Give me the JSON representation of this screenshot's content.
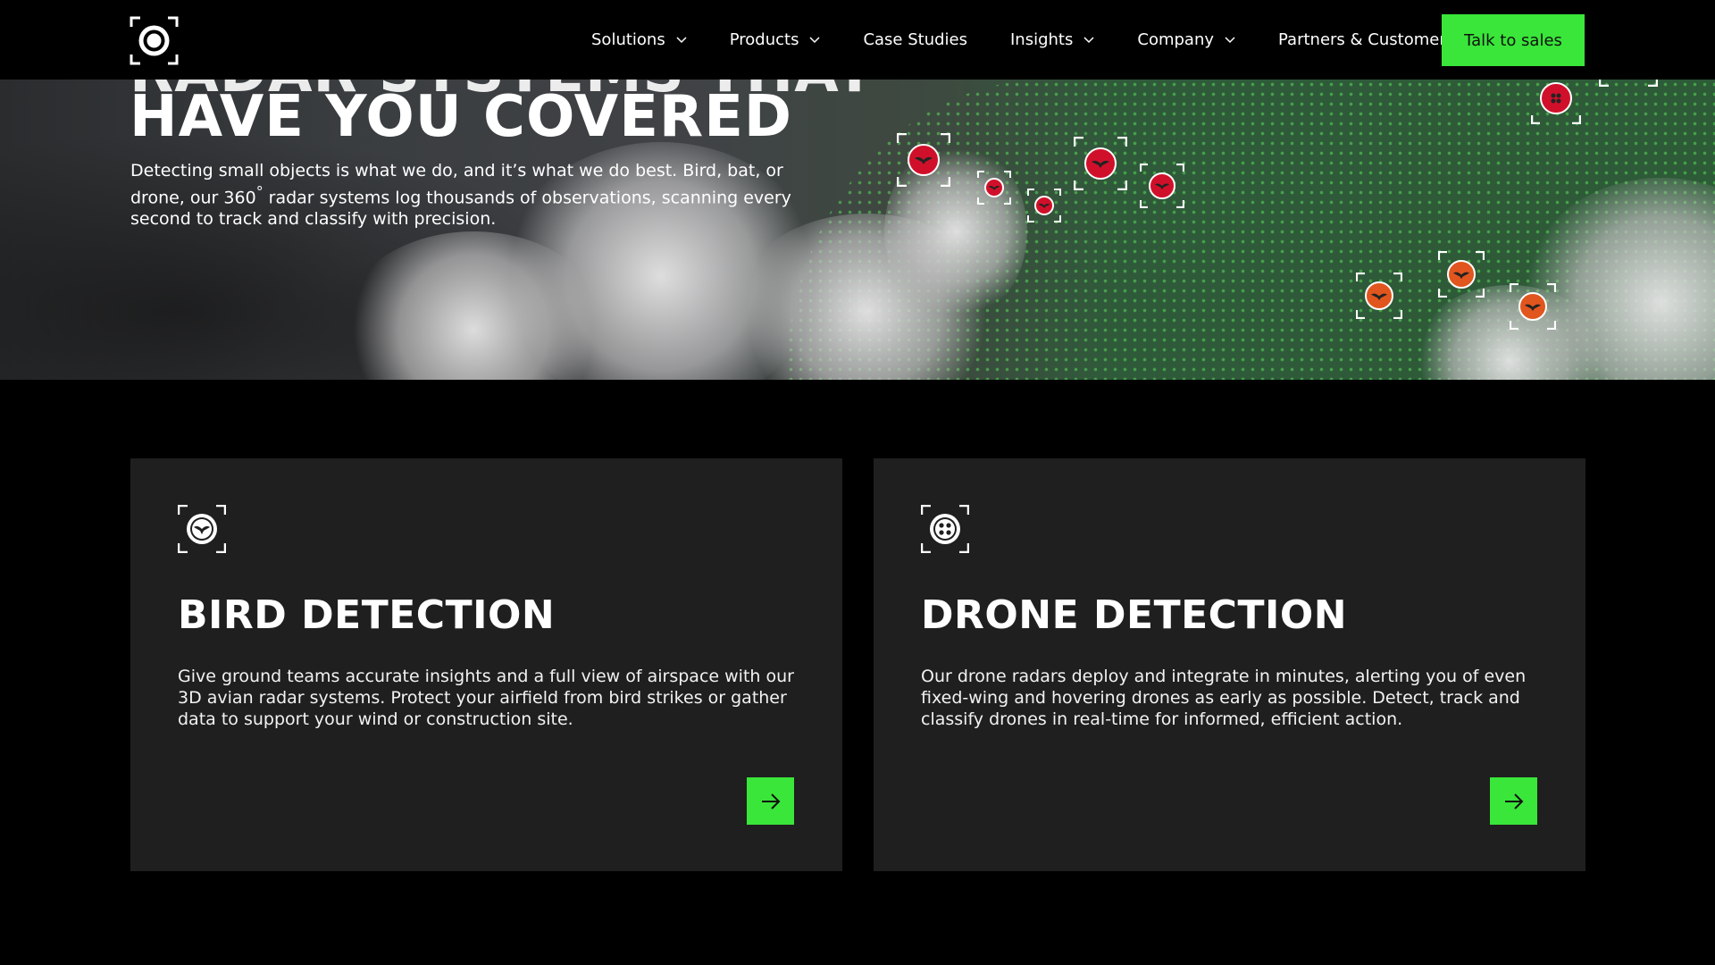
{
  "nav": {
    "logo_icon": "radar-logo-icon",
    "items": [
      {
        "label": "Solutions",
        "has_dropdown": true
      },
      {
        "label": "Products",
        "has_dropdown": true
      },
      {
        "label": "Case Studies",
        "has_dropdown": false
      },
      {
        "label": "Insights",
        "has_dropdown": true
      },
      {
        "label": "Company",
        "has_dropdown": true
      },
      {
        "label": "Partners & Customers",
        "has_dropdown": false
      }
    ],
    "cta_label": "Talk to sales"
  },
  "hero": {
    "title_cut": "RADAR SYSTEMS THAT",
    "title": "HAVE YOU COVERED",
    "text_a": "Detecting small objects is what we do, and it’s what we do best. Bird, bat, or drone, our 360",
    "text_sup": "°",
    "text_b": " radar systems log thousands of observations, scanning every second to track and classify with precision."
  },
  "cards": [
    {
      "icon": "bird-target-icon",
      "title": "BIRD DETECTION",
      "text": "Give ground teams accurate insights and a full view of airspace with our 3D avian radar systems. Protect your airfield from bird strikes or gather data to support your wind or construction site.",
      "arrow_icon": "arrow-right-icon"
    },
    {
      "icon": "drone-target-icon",
      "title": "DRONE DETECTION",
      "text": "Our drone radars deploy and integrate in minutes, alerting you of even fixed-wing and hovering drones as early as possible. Detect, track and classify drones in real-time for informed, efficient action.",
      "arrow_icon": "arrow-right-icon"
    }
  ],
  "colors": {
    "accent": "#39e639",
    "card_bg": "#1f1f1f",
    "target_red": "#d0102a",
    "target_orange": "#e0561e"
  }
}
